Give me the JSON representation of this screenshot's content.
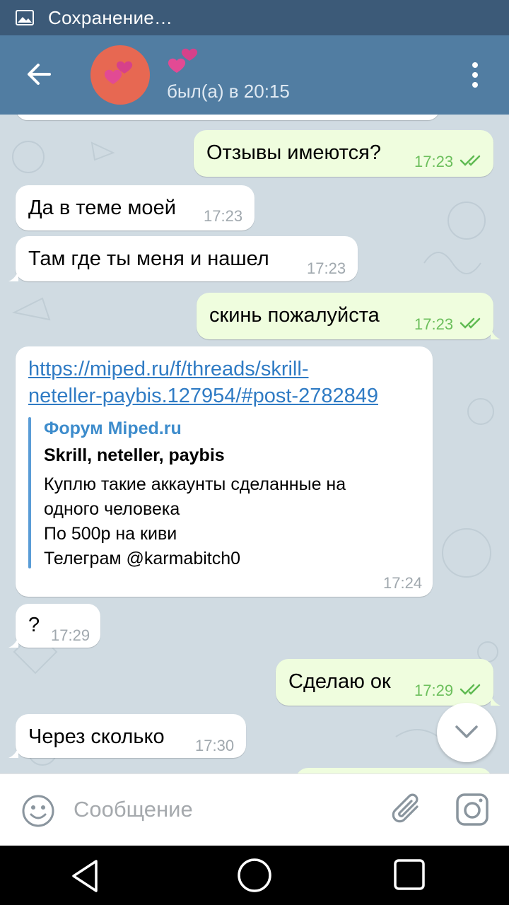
{
  "status_bar": {
    "text": "Сохранение…",
    "icon": "image-icon"
  },
  "header": {
    "contact_name_icon": "hearts-emoji-icon",
    "last_seen": "был(а) в 20:15",
    "avatar_color": "#e76852",
    "background_color": "#517da2"
  },
  "messages": [
    {
      "direction": "out",
      "text": "Отзывы имеются?",
      "time": "17:23",
      "status": "read"
    },
    {
      "direction": "in",
      "text": "Да в теме моей",
      "time": "17:23"
    },
    {
      "direction": "in",
      "text": "Там где ты меня и нашел",
      "time": "17:23"
    },
    {
      "direction": "out",
      "text": "скинь пожалуйста",
      "time": "17:23",
      "status": "read"
    },
    {
      "direction": "in",
      "link_line1": "https://miped.ru/f/threads/skrill-",
      "link_line2": "neteller-paybis.127954/#post-2782849",
      "preview": {
        "site": "Форум Miped.ru",
        "title": "Skrill, neteller, paybis",
        "desc_line1": "Куплю такие аккаунты сделанные на",
        "desc_line2": "одного человека",
        "desc_line3": "По 500р на киви",
        "desc_line4": "Телеграм @karmabitch0"
      },
      "time": "17:24"
    },
    {
      "direction": "in",
      "text": "?",
      "time": "17:29"
    },
    {
      "direction": "out",
      "text": "Сделаю ок",
      "time": "17:29",
      "status": "read"
    },
    {
      "direction": "in",
      "text": "Через сколько",
      "time": "17:30"
    }
  ],
  "composer": {
    "placeholder": "Сообщение"
  },
  "colors": {
    "incoming_bubble": "#ffffff",
    "outgoing_bubble": "#effdde",
    "outgoing_time": "#6cbf5c",
    "link": "#2f7bc4"
  }
}
